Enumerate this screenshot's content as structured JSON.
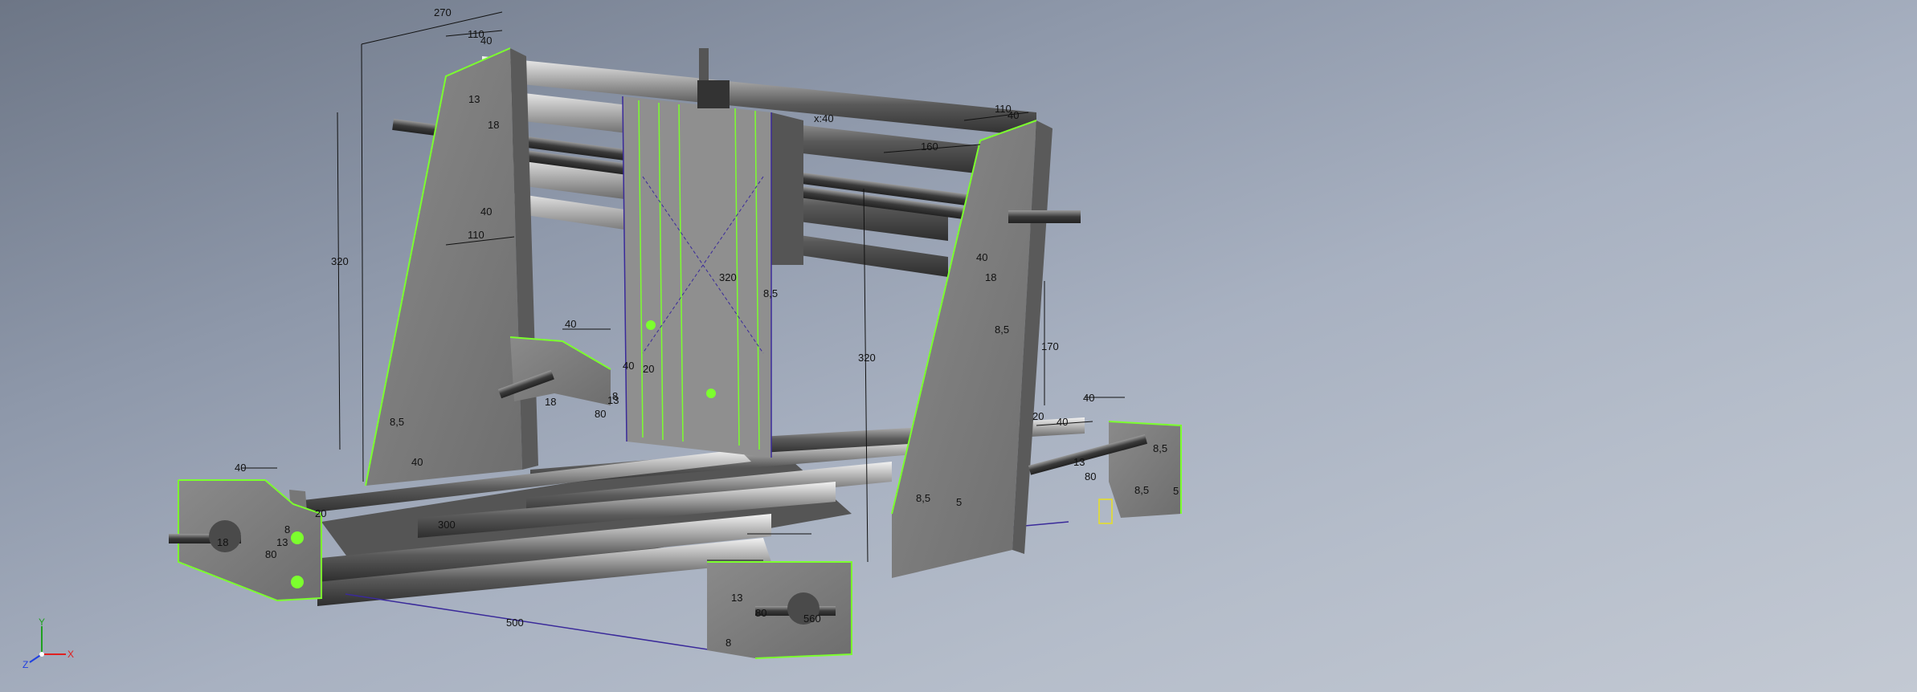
{
  "viewport": {
    "model": "cnc-router-frame-assembly",
    "edge_highlight_color": "#7cff2e",
    "sketch_color": "#3a2a9a",
    "dimensions": [
      {
        "id": "d1",
        "text": "270"
      },
      {
        "id": "d2",
        "text": "110"
      },
      {
        "id": "d3",
        "text": "40"
      },
      {
        "id": "d4",
        "text": "320"
      },
      {
        "id": "d5",
        "text": "18"
      },
      {
        "id": "d6",
        "text": "13"
      },
      {
        "id": "d7",
        "text": "40"
      },
      {
        "id": "d8",
        "text": "110"
      },
      {
        "id": "d9",
        "text": "40"
      },
      {
        "id": "d10",
        "text": "110"
      },
      {
        "id": "d11",
        "text": "160"
      },
      {
        "id": "d12",
        "text": "320"
      },
      {
        "id": "d13",
        "text": "170"
      },
      {
        "id": "d14",
        "text": "40"
      },
      {
        "id": "d15",
        "text": "20"
      },
      {
        "id": "d16",
        "text": "40"
      },
      {
        "id": "d17",
        "text": "13"
      },
      {
        "id": "d18",
        "text": "80"
      },
      {
        "id": "d19",
        "text": "8,5"
      },
      {
        "id": "d20",
        "text": "8,5"
      },
      {
        "id": "d21",
        "text": "5"
      },
      {
        "id": "d22",
        "text": "40"
      },
      {
        "id": "d23",
        "text": "40"
      },
      {
        "id": "d24",
        "text": "20"
      },
      {
        "id": "d25",
        "text": "80"
      },
      {
        "id": "d26",
        "text": "13"
      },
      {
        "id": "d27",
        "text": "8"
      },
      {
        "id": "d28",
        "text": "18"
      },
      {
        "id": "d29",
        "text": "40"
      },
      {
        "id": "d30",
        "text": "20"
      },
      {
        "id": "d31",
        "text": "80"
      },
      {
        "id": "d32",
        "text": "13"
      },
      {
        "id": "d33",
        "text": "8"
      },
      {
        "id": "d34",
        "text": "18"
      },
      {
        "id": "d35",
        "text": "80"
      },
      {
        "id": "d36",
        "text": "13"
      },
      {
        "id": "d37",
        "text": "8"
      },
      {
        "id": "d38",
        "text": "560"
      },
      {
        "id": "d39",
        "text": "500"
      },
      {
        "id": "d40",
        "text": "300"
      },
      {
        "id": "d41",
        "text": "320"
      },
      {
        "id": "d42",
        "text": "8,5"
      },
      {
        "id": "d43",
        "text": "8,5"
      },
      {
        "id": "d44",
        "text": "40"
      },
      {
        "id": "d45",
        "text": "18"
      },
      {
        "id": "d46",
        "text": "8,5"
      },
      {
        "id": "d47",
        "text": "8,5"
      },
      {
        "id": "d48",
        "text": "5"
      },
      {
        "id": "d49",
        "text": "40"
      },
      {
        "id": "d50",
        "text": "x:40"
      }
    ]
  },
  "view_triad": {
    "x_label": "X",
    "y_label": "Y",
    "z_label": "Z",
    "x_color": "#e02020",
    "y_color": "#20a020",
    "z_color": "#2040e0"
  }
}
